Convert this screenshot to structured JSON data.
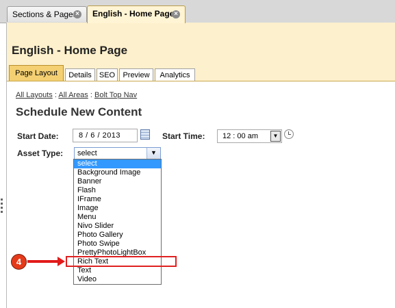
{
  "window_tabs": [
    {
      "label": "Sections & Pages",
      "active": false
    },
    {
      "label": "English - Home Page",
      "active": true
    }
  ],
  "page_title": "English - Home Page",
  "page_tabs": [
    "Page Layout",
    "Details",
    "SEO",
    "Preview",
    "Analytics"
  ],
  "breadcrumb": {
    "items": [
      "All Layouts",
      "All Areas",
      "Bolt Top Nav"
    ],
    "separator": ":"
  },
  "section_title": "Schedule New Content",
  "form": {
    "start_date_label": "Start Date:",
    "start_date_value": "8  /  6  /  2013",
    "start_time_label": "Start Time:",
    "start_time_value": "12 : 00   am",
    "asset_type_label": "Asset Type:",
    "asset_type_value": "select"
  },
  "asset_options": [
    "select",
    "Background Image",
    "Banner",
    "Flash",
    "IFrame",
    "Image",
    "Menu",
    "Nivo Slider",
    "Photo Gallery",
    "Photo Swipe",
    "PrettyPhotoLightBox",
    "Rich Text",
    "Text",
    "Video"
  ],
  "selected_option_index": 0,
  "highlighted_option_index": 11,
  "annotation": {
    "step_number": "4"
  },
  "colors": {
    "accent": "#f4d073",
    "header_bg": "#fdf0cc",
    "highlight": "#e02020",
    "selection": "#3399ff"
  }
}
